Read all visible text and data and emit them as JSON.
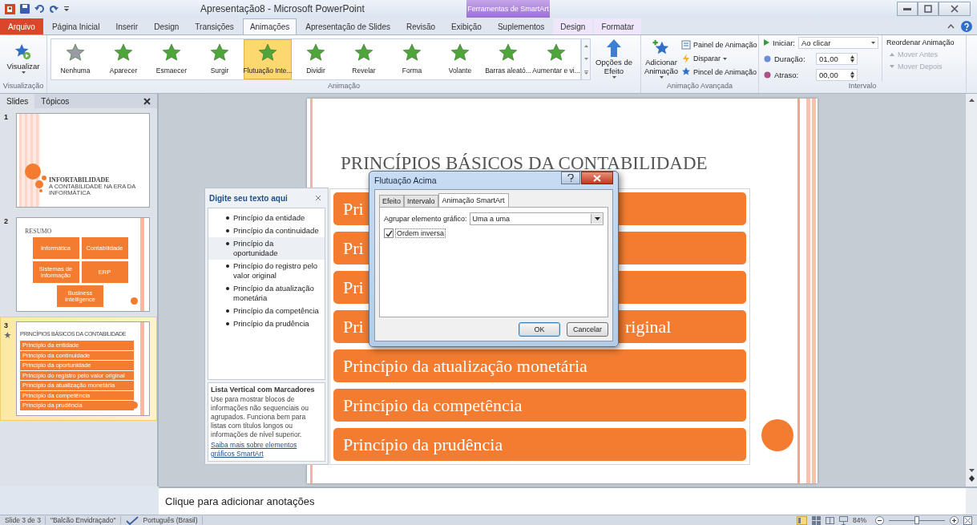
{
  "window": {
    "title": "Apresentação8 - Microsoft PowerPoint",
    "context_group": "Ferramentas de SmartArt"
  },
  "tabs": [
    {
      "label": "Arquivo",
      "kind": "file",
      "selected": false
    },
    {
      "label": "Página Inicial",
      "kind": "normal",
      "selected": false
    },
    {
      "label": "Inserir",
      "kind": "normal",
      "selected": false
    },
    {
      "label": "Design",
      "kind": "normal",
      "selected": false
    },
    {
      "label": "Transições",
      "kind": "normal",
      "selected": false
    },
    {
      "label": "Animações",
      "kind": "normal",
      "selected": true
    },
    {
      "label": "Apresentação de Slides",
      "kind": "normal",
      "selected": false
    },
    {
      "label": "Revisão",
      "kind": "normal",
      "selected": false
    },
    {
      "label": "Exibição",
      "kind": "normal",
      "selected": false
    },
    {
      "label": "Suplementos",
      "kind": "normal",
      "selected": false
    },
    {
      "label": "Design",
      "kind": "contextual",
      "selected": false
    },
    {
      "label": "Formatar",
      "kind": "contextual",
      "selected": false
    }
  ],
  "preview_group": {
    "label": "Visualização",
    "button": "Visualizar"
  },
  "animation_group": {
    "label": "Animação",
    "effect_options": "Opções de Efeito",
    "gallery": [
      {
        "label": "Nenhuma",
        "kind": "none",
        "selected": false
      },
      {
        "label": "Aparecer",
        "kind": "effect",
        "selected": false
      },
      {
        "label": "Esmaecer",
        "kind": "effect",
        "selected": false
      },
      {
        "label": "Surgir",
        "kind": "effect",
        "selected": false
      },
      {
        "label": "Flutuação Inte...",
        "kind": "effect",
        "selected": true
      },
      {
        "label": "Dividir",
        "kind": "effect",
        "selected": false
      },
      {
        "label": "Revelar",
        "kind": "effect",
        "selected": false
      },
      {
        "label": "Forma",
        "kind": "effect",
        "selected": false
      },
      {
        "label": "Volante",
        "kind": "effect",
        "selected": false
      },
      {
        "label": "Barras aleató...",
        "kind": "effect",
        "selected": false
      },
      {
        "label": "Aumentar e vi...",
        "kind": "effect",
        "selected": false
      }
    ]
  },
  "advanced_group": {
    "label": "Animação Avançada",
    "add": "Adicionar Animação",
    "commands": [
      {
        "label": "Painel de Animação",
        "kind": "pane",
        "dropdown": false
      },
      {
        "label": "Disparar",
        "kind": "trigger",
        "dropdown": true
      },
      {
        "label": "Pincel de Animação",
        "kind": "painter",
        "dropdown": false
      }
    ]
  },
  "timing_group": {
    "label": "Intervalo",
    "start": {
      "label": "Iniciar:",
      "value": "Ao clicar"
    },
    "duration": {
      "label": "Duração:",
      "value": "01,00"
    },
    "delay": {
      "label": "Atraso:",
      "value": "00,00"
    },
    "reorder": {
      "label": "Reordenar Animação",
      "items": [
        {
          "label": "Mover Antes",
          "kind": "up",
          "disabled": true
        },
        {
          "label": "Mover Depois",
          "kind": "down",
          "disabled": true
        }
      ]
    }
  },
  "slides_panel": {
    "tabs": [
      {
        "label": "Slides",
        "selected": true
      },
      {
        "label": "Tópicos",
        "selected": false
      }
    ],
    "slides": [
      {
        "number": "1",
        "kind": "title",
        "selected": false,
        "animated": false,
        "title": "INFORTABILIDADE",
        "subtitle": "A CONTABILIDADE NA ERA DA INFORMÁTICA"
      },
      {
        "number": "2",
        "kind": "boxes",
        "selected": false,
        "animated": false,
        "title": "RESUMO",
        "boxes": [
          "Informática",
          "Contabilidade",
          "Sistemas de Informação",
          "ERP",
          "Business Intelligence"
        ]
      },
      {
        "number": "3",
        "kind": "list",
        "selected": true,
        "animated": true,
        "title": "PRINCÍPIOS BÁSICOS DA CONTABILIDADE",
        "items": [
          "Princípio da entidade",
          "Princípio da continuidade",
          "Princípio da oportunidade",
          "Princípio do registro pelo valor original",
          "Princípio da atualização monetária",
          "Princípio da competência",
          "Princípio da prudência"
        ]
      }
    ]
  },
  "slide": {
    "title": "PRINCÍPIOS BÁSICOS DA CONTABILIDADE",
    "rows": [
      {
        "text": "Pri"
      },
      {
        "text": "Pri"
      },
      {
        "text": "Pri"
      },
      {
        "text": "Pri",
        "tail": "riginal"
      },
      {
        "text": "Princípio da atualização monetária"
      },
      {
        "text": "Princípio da competência"
      },
      {
        "text": "Princípio da prudência"
      }
    ]
  },
  "text_pane": {
    "title": "Digite seu texto aqui",
    "items": [
      {
        "text": "Princípio da entidade",
        "selected": false
      },
      {
        "text": "Princípio da continuidade",
        "selected": false
      },
      {
        "text": "Princípio da oportunidade",
        "selected": true
      },
      {
        "text": "Princípio do registro pelo valor original",
        "selected": false
      },
      {
        "text": "Princípio da atualização monetária",
        "selected": false
      },
      {
        "text": "Princípio da competência",
        "selected": false
      },
      {
        "text": "Princípio da prudência",
        "selected": false
      }
    ],
    "layout_name": "Lista Vertical com Marcadores",
    "description": "Use para mostrar blocos de informações não sequenciais ou agrupados. Funciona bem para listas com títulos longos ou informações de nível superior.",
    "link": "Saiba mais sobre elementos gráficos SmartArt"
  },
  "dialog": {
    "title": "Flutuação Acima",
    "tabs": [
      {
        "label": "Efeito",
        "selected": false
      },
      {
        "label": "Intervalo",
        "selected": false
      },
      {
        "label": "Animação SmartArt",
        "selected": true
      }
    ],
    "group_label": "Agrupar elemento gráfico:",
    "group_value": "Uma a uma",
    "checkbox": {
      "label": "Ordem inversa",
      "checked": true
    },
    "buttons": [
      "OK",
      "Cancelar"
    ]
  },
  "notes": {
    "placeholder": "Clique para adicionar anotações"
  },
  "status_bar": {
    "slide": "Slide 3 de 3",
    "theme": "\"Balcão Envidraçado\"",
    "language": "Português (Brasil)",
    "zoom": "84%",
    "zoom_slider": {
      "level": 0.5
    }
  }
}
